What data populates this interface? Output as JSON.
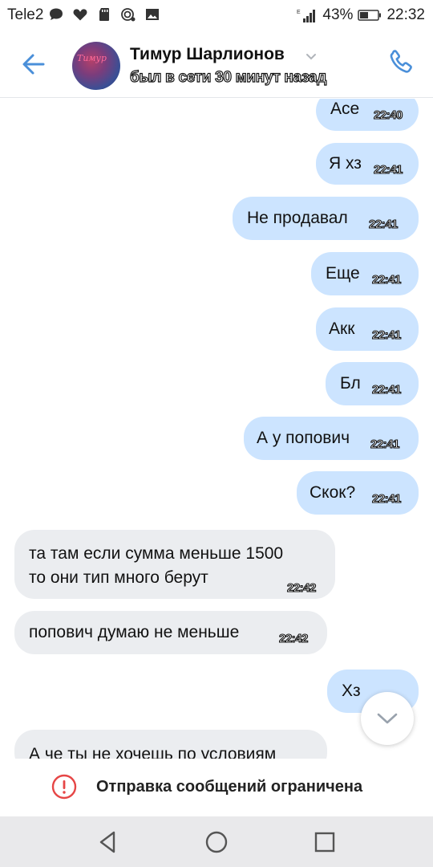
{
  "status_bar": {
    "carrier": "Tele2",
    "battery": "43%",
    "time": "22:32",
    "icons": [
      "chat-bubble-icon",
      "heart-icon",
      "sd-card-icon",
      "nfc-icon",
      "image-icon",
      "signal-icon",
      "battery-icon"
    ]
  },
  "header": {
    "contact_name": "Тимур Шарлионов",
    "status": "был в сети 30 минут назад",
    "avatar_text": "Тимур"
  },
  "messages": [
    {
      "dir": "out",
      "text": "Асе",
      "time": "22:40"
    },
    {
      "dir": "out",
      "text": "Я хз",
      "time": "22:41"
    },
    {
      "dir": "out",
      "text": "Не продавал",
      "time": "22:41"
    },
    {
      "dir": "out",
      "text": "Еще",
      "time": "22:41"
    },
    {
      "dir": "out",
      "text": "Акк",
      "time": "22:41"
    },
    {
      "dir": "out",
      "text": "Бл",
      "time": "22:41"
    },
    {
      "dir": "out",
      "text": "А у попович",
      "time": "22:41"
    },
    {
      "dir": "out",
      "text": "Скок?",
      "time": "22:41"
    },
    {
      "dir": "in",
      "text": "та там если сумма меньше 1500\nто они тип много берут",
      "time": "22:42"
    },
    {
      "dir": "in",
      "text": "попович думаю не меньше",
      "time": "22:42"
    },
    {
      "dir": "out",
      "text": "Хз",
      "time": ""
    },
    {
      "dir": "in",
      "text": "А че ты не хочешь по условиям",
      "time": ""
    }
  ],
  "restricted": {
    "text": "Отправка сообщений ограничена"
  },
  "colors": {
    "accent": "#4a8fd9",
    "outgoing_bubble": "#cce4ff",
    "incoming_bubble": "#ebedf0",
    "warning": "#e64646"
  }
}
